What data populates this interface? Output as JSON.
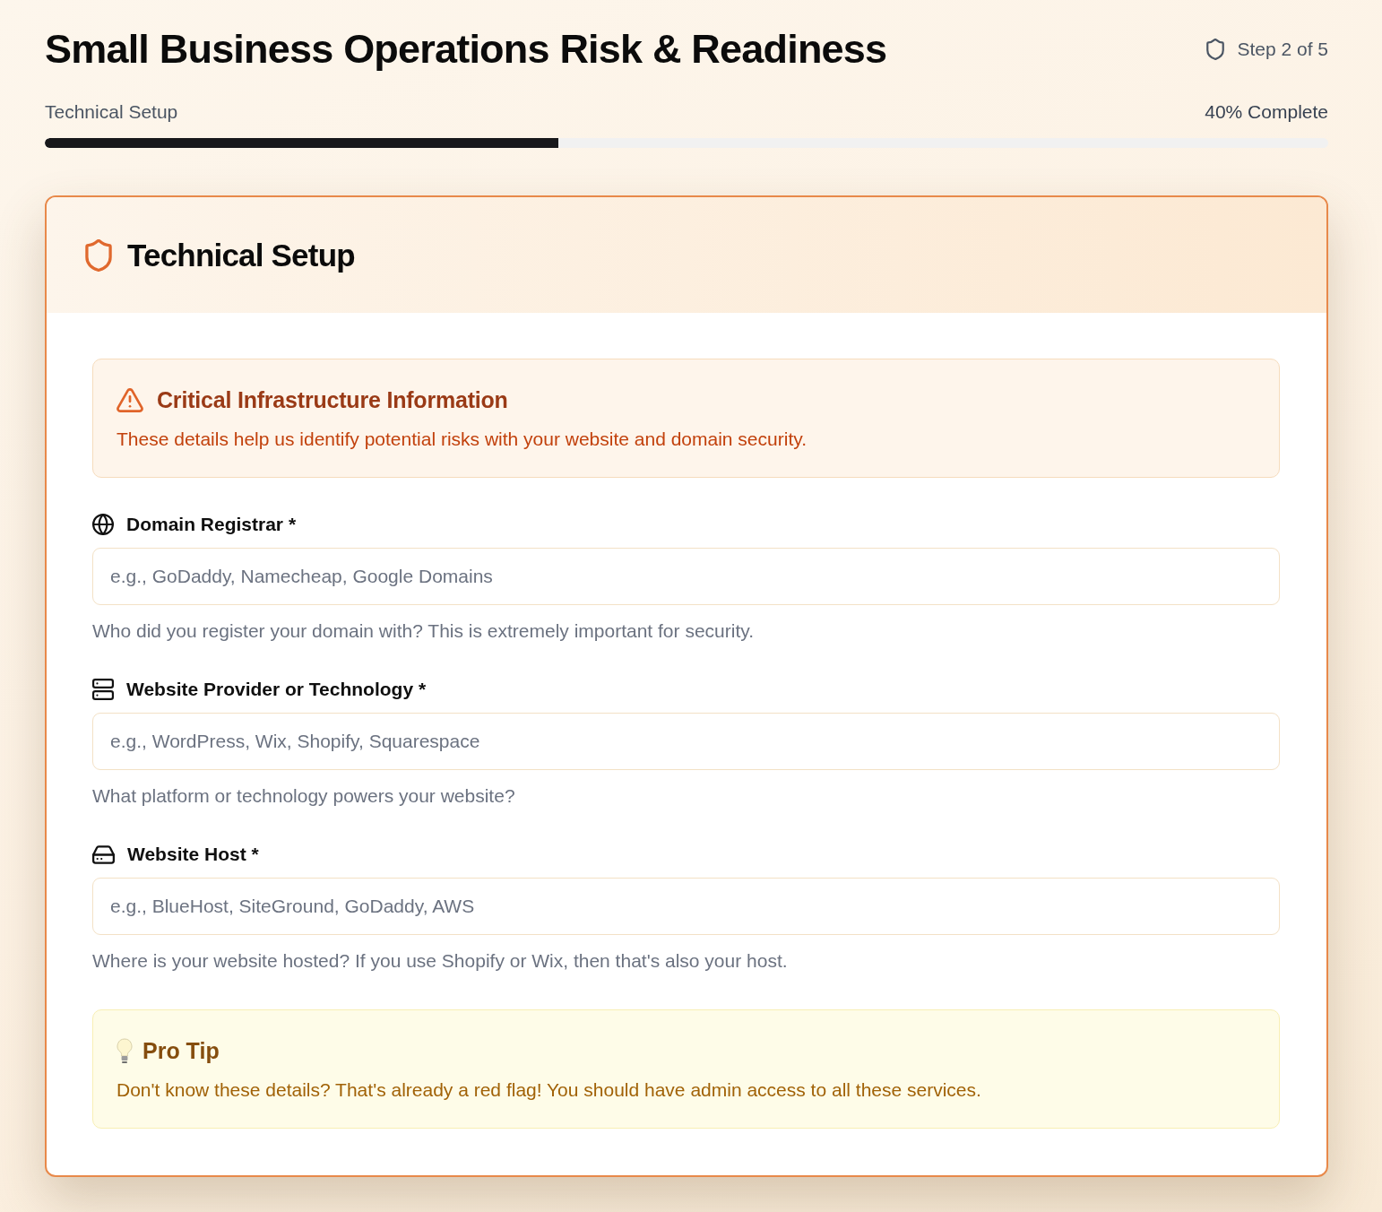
{
  "header": {
    "title": "Small Business Operations Risk & Readiness",
    "step": "Step 2 of 5"
  },
  "progress": {
    "section": "Technical Setup",
    "reading": "40% Complete",
    "level": 0.4
  },
  "card": {
    "title": "Technical Setup",
    "alert": {
      "title": "Critical Infrastructure Information",
      "text": "These details help us identify potential risks with your website and domain security."
    },
    "fields": [
      {
        "kind": "domain",
        "label": "Domain Registrar *",
        "placeholder": "e.g., GoDaddy, Namecheap, Google Domains",
        "help": "Who did you register your domain with? This is extremely important for security."
      },
      {
        "kind": "platform",
        "label": "Website Provider or Technology *",
        "placeholder": "e.g., WordPress, Wix, Shopify, Squarespace",
        "help": "What platform or technology powers your website?"
      },
      {
        "kind": "hosting",
        "label": "Website Host *",
        "placeholder": "e.g., BlueHost, SiteGround, GoDaddy, AWS",
        "help": "Where is your website hosted? If you use Shopify or Wix, then that's also your host."
      }
    ],
    "tip": {
      "title": "Pro Tip",
      "text": "Don't know these details? That's already a red flag! You should have admin access to all these services."
    }
  }
}
